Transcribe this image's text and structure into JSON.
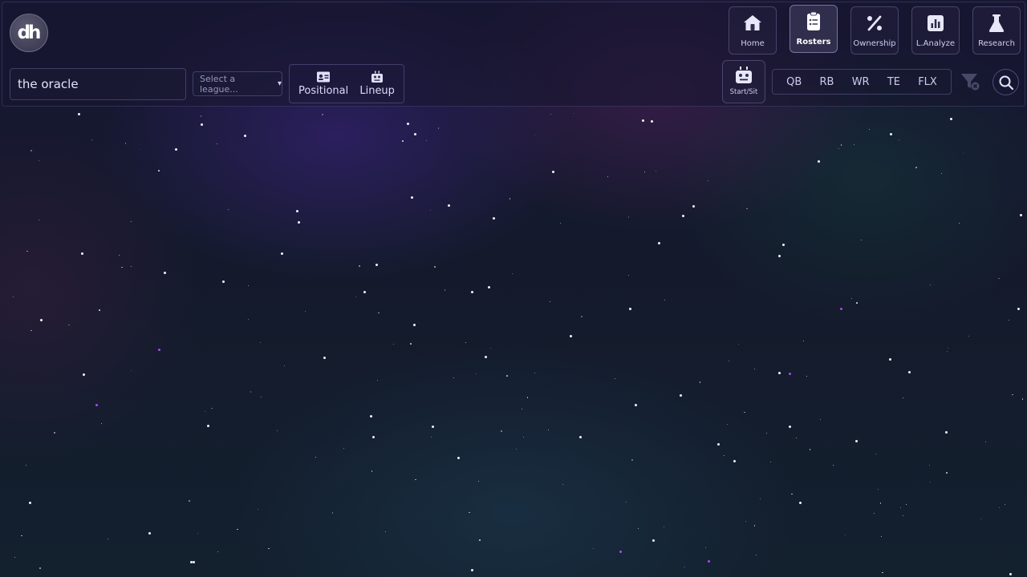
{
  "app": {
    "logo_text": "dh"
  },
  "search": {
    "value": "the oracle",
    "placeholder": ""
  },
  "league_select": {
    "selected": "Select a league...",
    "arrow": "▾"
  },
  "views": [
    {
      "label": "Positional",
      "icon": "id-card-icon"
    },
    {
      "label": "Lineup",
      "icon": "robot-icon"
    }
  ],
  "nav": [
    {
      "label": "Home",
      "icon": "home-icon",
      "active": false
    },
    {
      "label": "Rosters",
      "icon": "clipboard-list-icon",
      "active": true
    },
    {
      "label": "Ownership",
      "icon": "percent-icon",
      "active": false
    },
    {
      "label": "L.Analyze",
      "icon": "bar-chart-icon",
      "active": false
    },
    {
      "label": "Research",
      "icon": "flask-icon",
      "active": false
    }
  ],
  "start_sit": {
    "label": "Start/Sit",
    "icon": "robot-icon"
  },
  "positions": [
    "QB",
    "RB",
    "WR",
    "TE",
    "FLX"
  ],
  "colors": {
    "background_top": "#171733",
    "background_bottom": "#13202e",
    "text": "#cdcbee",
    "star": "#ffffff",
    "star_accent": "#b04cff"
  }
}
